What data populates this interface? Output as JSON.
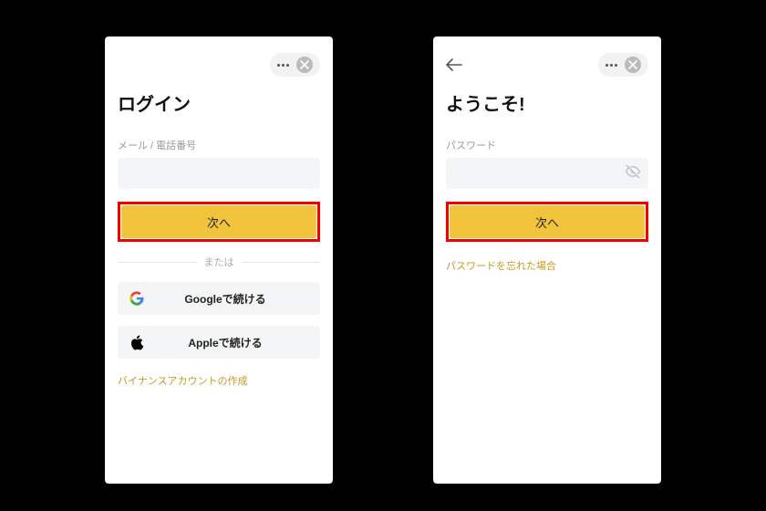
{
  "colors": {
    "accent": "#f1c43b",
    "link": "#c99a1f",
    "highlight_frame": "#f20000"
  },
  "screen1": {
    "title": "ログイン",
    "field_label": "メール / 電話番号",
    "input_value": "",
    "primary_button": "次へ",
    "divider_text": "または",
    "social": {
      "google": "Googleで続ける",
      "apple": "Appleで続ける"
    },
    "create_account_link": "バイナンスアカウントの作成"
  },
  "screen2": {
    "title": "ようこそ!",
    "field_label": "パスワード",
    "input_value": "",
    "primary_button": "次へ",
    "forgot_password_link": "パスワードを忘れた場合"
  },
  "icons": {
    "more": "more-icon",
    "close": "close-icon",
    "back": "back-arrow-icon",
    "google": "google-logo-icon",
    "apple": "apple-logo-icon",
    "eye_off": "eye-off-icon"
  }
}
